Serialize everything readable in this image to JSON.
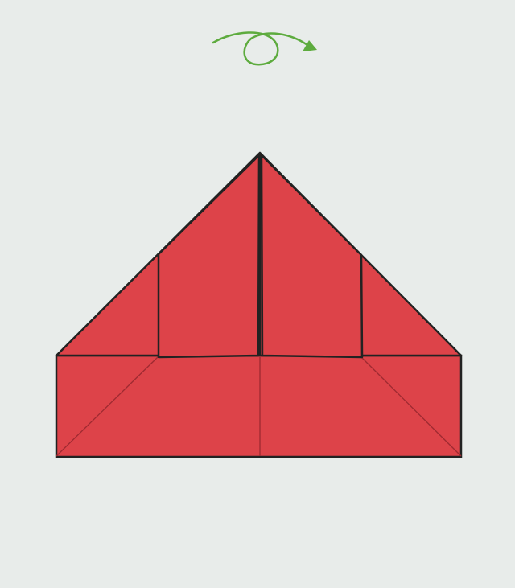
{
  "diagram": {
    "instruction_icon": "turn-over-arrow-icon",
    "colors": {
      "background": "#e8ecea",
      "paper": "#dd4349",
      "outline": "#222222",
      "crease": "#9e2a31",
      "arrow": "#5dab3e"
    }
  }
}
